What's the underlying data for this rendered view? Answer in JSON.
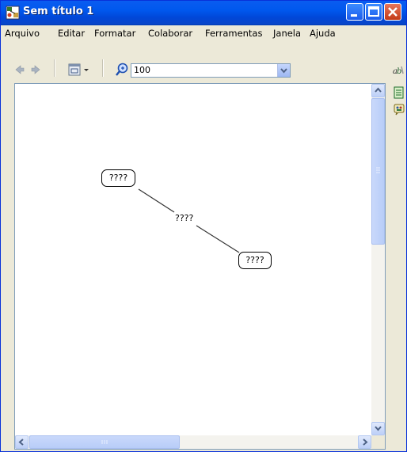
{
  "window": {
    "title": "Sem título 1"
  },
  "menu": {
    "items": [
      "Arquivo",
      "Editar",
      "Formatar",
      "Colaborar",
      "Ferramentas",
      "Janela",
      "Ajuda"
    ]
  },
  "toolbar": {
    "zoom_value": "100"
  },
  "map": {
    "concepts": [
      {
        "label": "????"
      },
      {
        "label": "????"
      }
    ],
    "link_label": "????"
  },
  "icons": {
    "title": "cmap-app-icon",
    "back": "back-arrow-icon",
    "forward": "forward-arrow-icon",
    "view": "view-toggle-icon",
    "zoom": "zoom-icon",
    "side": [
      "styles-palette-icon",
      "document-icon",
      "collaboration-icon"
    ]
  },
  "colors": {
    "titlebar": "#0054e3",
    "window_bg": "#ece9d8",
    "scroll_thumb": "#c1d3fb"
  }
}
